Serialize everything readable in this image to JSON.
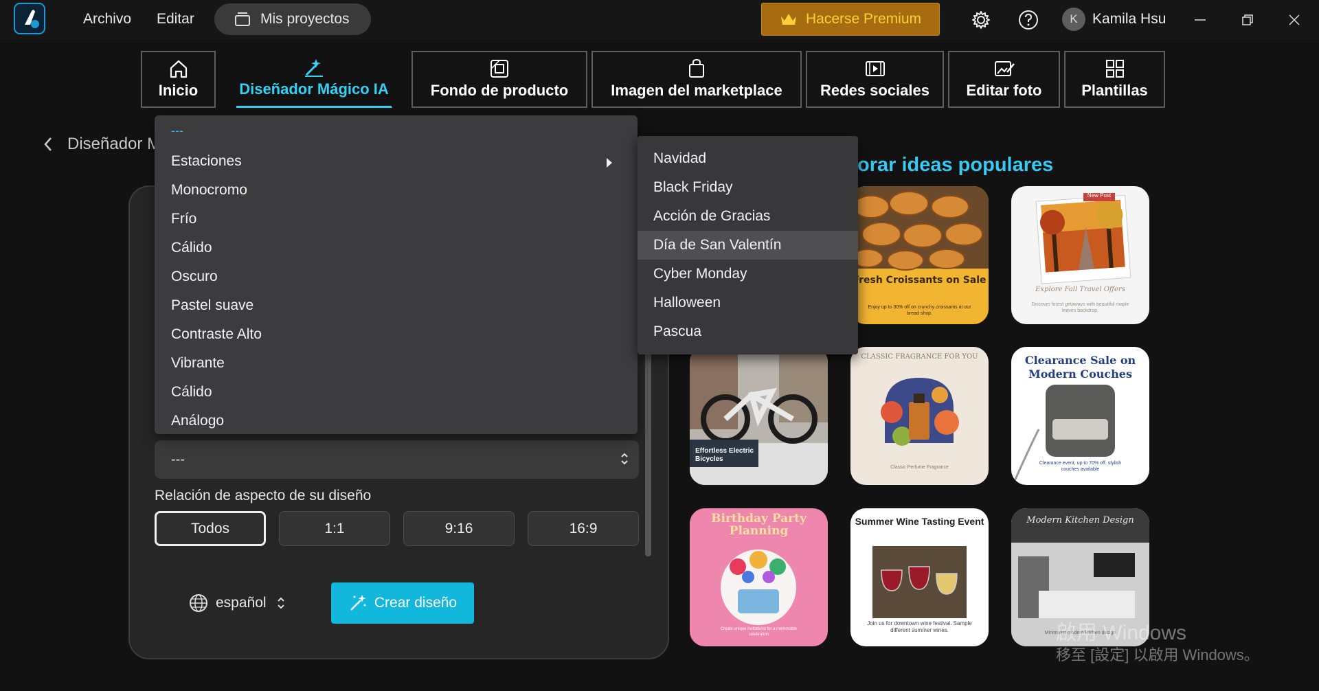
{
  "titlebar": {
    "menu_file": "Archivo",
    "menu_edit": "Editar",
    "projects": "Mis proyectos",
    "premium": "Hacerse Premium",
    "avatar_initial": "K",
    "username": "Kamila Hsu"
  },
  "tabs": [
    {
      "label": "Inicio",
      "icon": "home-icon"
    },
    {
      "label": "Diseñador Mágico IA",
      "icon": "magic-design-icon"
    },
    {
      "label": "Fondo de producto",
      "icon": "product-background-icon"
    },
    {
      "label": "Imagen del marketplace",
      "icon": "shopping-bag-icon"
    },
    {
      "label": "Redes sociales",
      "icon": "video-icon"
    },
    {
      "label": "Editar foto",
      "icon": "edit-photo-icon"
    },
    {
      "label": "Plantillas",
      "icon": "templates-icon"
    }
  ],
  "back_label": "Diseñador M",
  "dropdown": {
    "selected": "---",
    "items": [
      "Estaciones",
      "Monocromo",
      "Frío",
      "Cálido",
      "Oscuro",
      "Pastel suave",
      "Contraste Alto",
      "Vibrante",
      "Cálido",
      "Análogo"
    ]
  },
  "submenu": {
    "items": [
      "Navidad",
      "Black Friday",
      "Acción de Gracias",
      "Día de San Valentín",
      "Cyber Monday",
      "Halloween",
      "Pascua"
    ],
    "highlighted": "Día de San Valentín"
  },
  "form": {
    "second_select_value": "---",
    "ratio_label": "Relación de aspecto de su diseño",
    "ratios": [
      "Todos",
      "1:1",
      "9:16",
      "16:9"
    ],
    "language": "español",
    "create_button": "Crear diseño"
  },
  "gallery": {
    "title": "orar ideas populares",
    "cards": [
      {
        "title": "Fresh Croissants on Sale",
        "subtitle": "Enjoy up to 30% off on crunchy croissants at our bread shop."
      },
      {
        "title": "Explore Fall Travel Offers",
        "tag": "New Post",
        "subtitle": "Discover forest getaways with beautiful maple leaves backdrop."
      },
      {
        "title": "Effortless Electric Bicycles"
      },
      {
        "title": "CLASSIC FRAGRANCE FOR YOU",
        "subtitle": "Classic Perfume Fragrance"
      },
      {
        "title": "Clearance Sale on Modern Couches",
        "subtitle": "Clearance event, up to 70% off, stylish couches available"
      },
      {
        "title": "Birthday Party Planning",
        "subtitle": "Create unique invitations for a memorable celebration"
      },
      {
        "title": "Summer Wine Tasting Event",
        "subtitle": "Join us for downtown wine festival. Sample different summer wines."
      },
      {
        "title": "Modern Kitchen Design",
        "subtitle": "Minimalist modern kitchen design"
      }
    ]
  },
  "watermark": {
    "line1": "啟用 Windows",
    "line2": "移至 [設定] 以啟用 Windows。"
  },
  "colors": {
    "accent": "#35d0f5",
    "premium": "#ffcf37",
    "create": "#12b7dc"
  }
}
